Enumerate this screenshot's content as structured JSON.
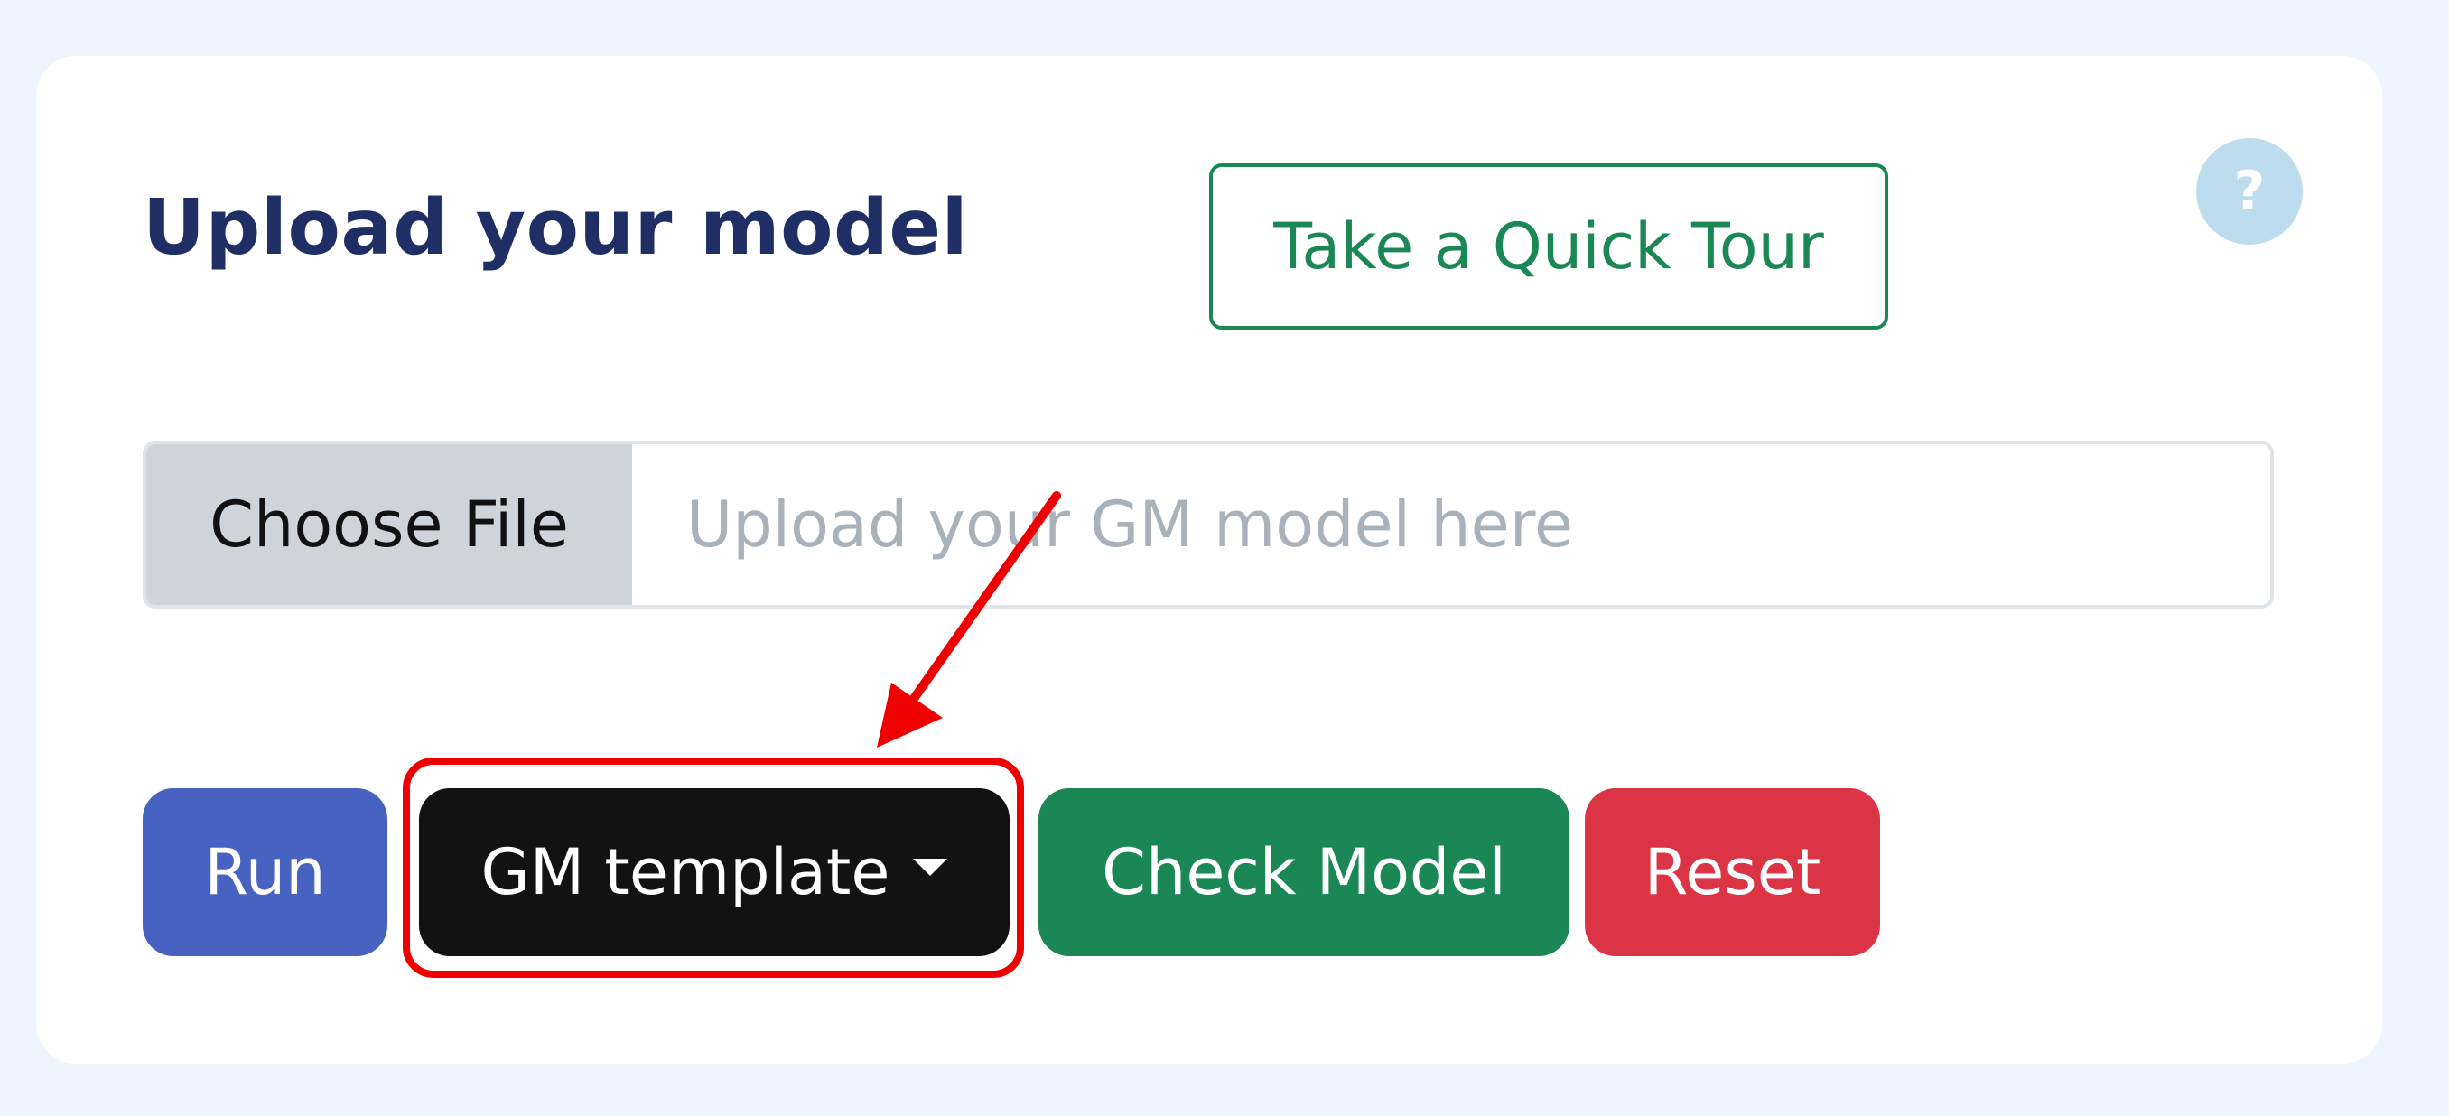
{
  "upload_panel": {
    "title": "Upload your model",
    "tour_button": "Take a Quick Tour",
    "help_icon": "?",
    "file_input": {
      "choose_label": "Choose File",
      "placeholder": "Upload your GM model here"
    },
    "actions": {
      "run": "Run",
      "gm_template": "GM template",
      "check_model": "Check Model",
      "reset": "Reset"
    }
  },
  "icons": {
    "help": "question-circle-icon",
    "dropdown": "caret-down-icon",
    "annotation": "arrow-annotation"
  },
  "colors": {
    "page_background": "#eff5fe",
    "card_background": "#ffffff",
    "title": "#1f2f66",
    "run": "#4862c1",
    "gm_template": "#121212",
    "check_model": "#1a8754",
    "reset": "#db3445",
    "annotation": "#ee0000"
  }
}
